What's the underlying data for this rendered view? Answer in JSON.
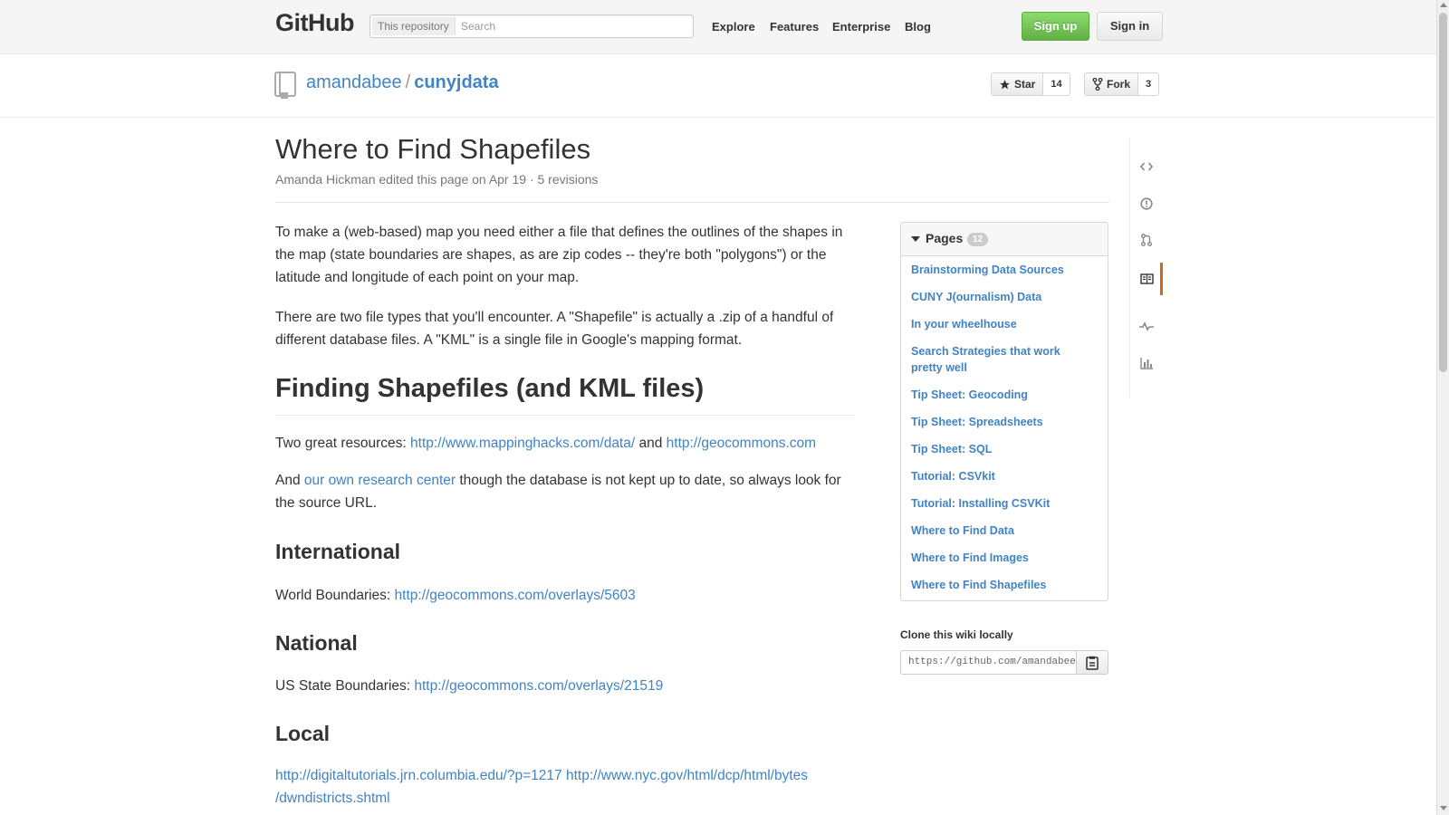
{
  "header": {
    "logo": "GitHub",
    "search_scope": "This repository",
    "search_placeholder": "Search",
    "nav": [
      "Explore",
      "Features",
      "Enterprise",
      "Blog"
    ],
    "signup_label": "Sign up",
    "signin_label": "Sign in"
  },
  "repo": {
    "owner": "amandabee",
    "separator": "/",
    "name": "cunyjdata",
    "star_label": "Star",
    "star_count": "14",
    "fork_label": "Fork",
    "fork_count": "3"
  },
  "wiki": {
    "title": "Where to Find Shapefiles",
    "meta": "Amanda Hickman edited this page on Apr 19 · 5 revisions",
    "p1": "To make a (web-based) map you need either a file that defines the outlines of the shapes in the map (state boundaries are shapes, as are zip codes -- they're both \"polygons\") or the latitude and longitude of each point on your map.",
    "p2": "There are two file types that you'll encounter. A \"Shapefile\" is actually a .zip of a handful of different database files. A \"KML\" is a single file in Google's mapping format.",
    "h1": "Finding Shapefiles (and KML files)",
    "resources_prefix": "Two great resources: ",
    "resources_link1": "http://www.mappinghacks.com/data/",
    "resources_and": " and ",
    "resources_link2": "http://geocommons.com",
    "research_prefix": "And ",
    "research_link": "our own research center",
    "research_suffix": " though the database is not kept up to date, so always look for the source URL.",
    "h2_international": "International",
    "world_prefix": "World Boundaries: ",
    "world_link": "http://geocommons.com/overlays/5603",
    "h2_national": "National",
    "us_prefix": "US State Boundaries: ",
    "us_link": "http://geocommons.com/overlays/21519",
    "h2_local": "Local",
    "local_link1": "http://digitaltutorials.jrn.columbia.edu/?p=1217",
    "local_link2_line1": "http://www.nyc.gov/html/dcp/html/bytes",
    "local_link2_line2": "/dwndistricts.shtml"
  },
  "sidebar": {
    "pages_title": "Pages",
    "pages_count": "12",
    "pages": [
      "Brainstorming Data Sources",
      "CUNY J(ournalism) Data",
      "In your wheelhouse",
      "Search Strategies that work pretty well",
      "Tip Sheet: Geocoding",
      "Tip Sheet: Spreadsheets",
      "Tip Sheet: SQL",
      "Tutorial: CSVkit",
      "Tutorial: Installing CSVKit",
      "Where to Find Data",
      "Where to Find Images",
      "Where to Find Shapefiles"
    ],
    "clone_label": "Clone this wiki locally",
    "clone_url": "https://github.com/amandabee/cunyjdata.wiki.git"
  },
  "vnav": {
    "icons": [
      "code-icon",
      "issues-icon",
      "pull-requests-icon",
      "wiki-icon",
      "pulse-icon",
      "graphs-icon"
    ],
    "active": "wiki-icon",
    "active_color": "#d26911"
  },
  "colors": {
    "link": "#4183c4",
    "signup_green": "#60b044",
    "text": "#333333",
    "muted": "#777777"
  }
}
